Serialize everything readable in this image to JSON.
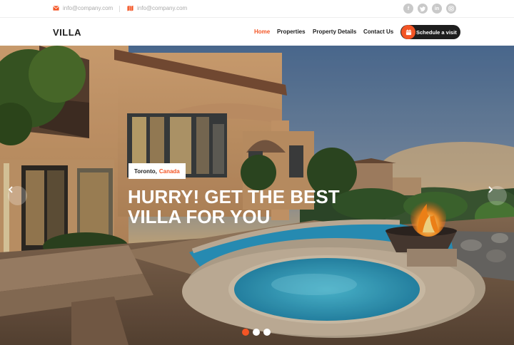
{
  "topbar": {
    "email_1": "info@company.com",
    "email_2": "info@company.com",
    "social": [
      "facebook-icon",
      "twitter-icon",
      "linkedin-icon",
      "instagram-icon"
    ]
  },
  "navbar": {
    "logo": "VILLA",
    "links": [
      "Home",
      "Properties",
      "Property Details",
      "Contact Us"
    ],
    "active_link": "Home",
    "cta": "Schedule a visit"
  },
  "hero": {
    "city": "Toronto,",
    "country": "Canada",
    "headline_line1": "Hurry! Get the Best",
    "headline_line2": "Villa for you",
    "slide_count": 3,
    "active_slide": 1
  },
  "colors": {
    "accent": "#f35525",
    "dark": "#1e1e1e",
    "muted": "#aaaaaa"
  }
}
